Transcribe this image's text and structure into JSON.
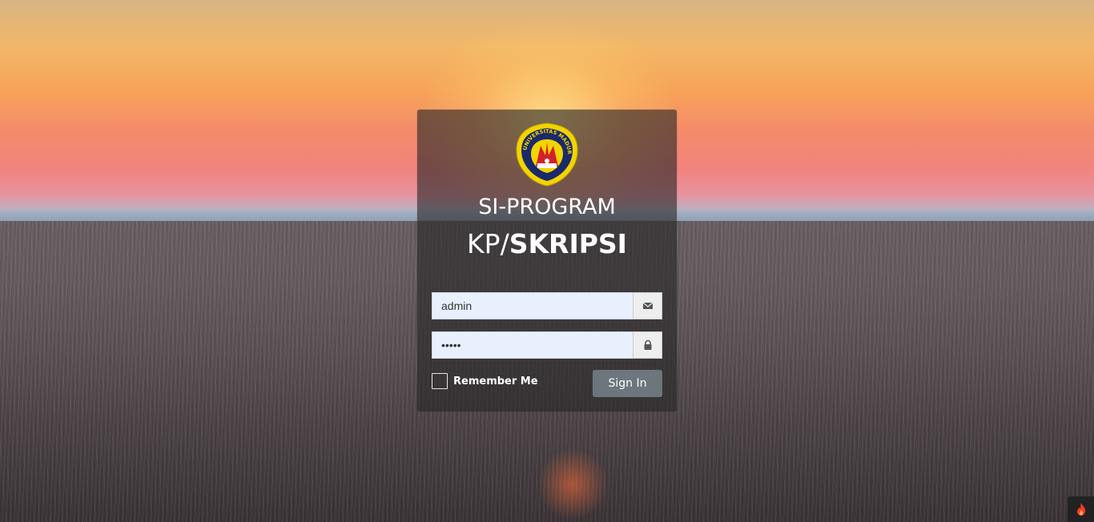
{
  "background": {
    "description_colors": {
      "sky_top": "#d7b484",
      "sky_mid": "#f6a458",
      "horizon": "#e7939e",
      "field": "#5e5458"
    }
  },
  "brand": {
    "logo_icon": "university-seal-icon",
    "logo_text": "UNIVERSITAS MADURA",
    "subtitle": "SI-PROGRAM",
    "title_prefix": "KP/",
    "title_bold": "SKRIPSI"
  },
  "form": {
    "username_value": "admin",
    "username_icon": "envelope-icon",
    "password_value": "admin",
    "password_icon": "lock-icon",
    "remember_label": "Remember Me",
    "remember_checked": false,
    "signin_label": "Sign In"
  },
  "corner_widget": {
    "icon": "fire-icon",
    "color": "#ff3b1f"
  }
}
